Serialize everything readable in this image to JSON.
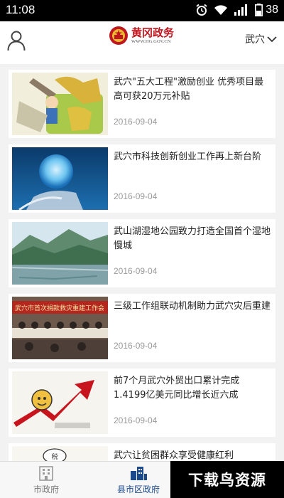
{
  "status_bar": {
    "time": "11:08",
    "battery": "38"
  },
  "header": {
    "logo_title": "黄冈政务",
    "logo_url": "WWW.HG.GOV.CN",
    "district": "武穴",
    "brand_color": "#c0161e"
  },
  "news": [
    {
      "title": "武穴\"五大工程\"激励创业 优秀项目最高可获20万元补贴",
      "date": "2016-09-04",
      "thumb": "entrepreneurship-illustration"
    },
    {
      "title": "武穴市科技创新创业工作再上新台阶",
      "date": "2016-09-04",
      "thumb": "globe-hand-photo"
    },
    {
      "title": "武山湖湿地公园致力打造全国首个湿地慢城",
      "date": "2016-09-04",
      "thumb": "wetland-landscape-photo"
    },
    {
      "title": "三级工作组联动机制助力武穴灾后重建",
      "date": "2016-09-04",
      "thumb": "meeting-room-photo"
    },
    {
      "title": "前7个月武穴外贸出口累计完成1.4199亿美元同比增长近六成",
      "date": "2016-09-04",
      "thumb": "growth-arrow-cartoon"
    },
    {
      "title": "武穴让贫困群众享受健康红利",
      "date": "",
      "thumb": "tax-cartoon"
    }
  ],
  "thumb_texts": {
    "banner": "武穴市首次捐款救灾重建工作会"
  },
  "bottom_nav": {
    "tabs": [
      {
        "label": "市政府",
        "icon": "building-icon"
      },
      {
        "label": "县市区政府",
        "icon": "city-icon"
      }
    ],
    "active_color": "#1a4a8c"
  },
  "watermark": "下载鸟资源"
}
